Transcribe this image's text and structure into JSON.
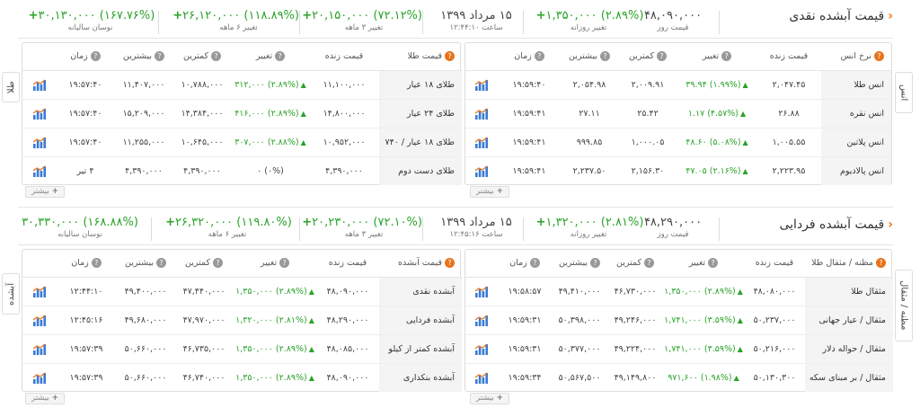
{
  "sections": [
    {
      "title": "قیمت آبشده نقدی",
      "stats": {
        "price": {
          "value": "۴۸,۰۹۰,۰۰۰",
          "label": "قیمت روز"
        },
        "daily": {
          "value": "(۲.۸۹%) ۱,۳۵۰,۰۰۰",
          "label": "تغییر روزانه"
        },
        "date": {
          "value": "۱۵ مرداد ۱۳۹۹",
          "label": "ساعت ۱۲:۴۴:۱۰"
        },
        "m3": {
          "value": "(۷۲.۱۲%) ۲۰,۱۵۰,۰۰۰",
          "label": "تغییر ۳ ماهه"
        },
        "m6": {
          "value": "(۱۱۸.۸۹%) ۲۶,۱۲۰,۰۰۰",
          "label": "تغییر ۶ ماهه"
        },
        "y1": {
          "value": "(۱۶۷.۷۶%) ۳۰,۱۳۰,۰۰۰",
          "label": "نوسان سالیانه"
        }
      },
      "right_panel": {
        "side_tab": "انس",
        "headers": [
          "نرخ انس",
          "قیمت زنده",
          "تغییر",
          "کمترین",
          "بیشترین",
          "زمان"
        ],
        "rows": [
          {
            "name": "انس طلا",
            "price": "۲,۰۴۷.۴۵",
            "change": "(۱.۹۹%) ۳۹.۹۴",
            "low": "۲,۰۰۹.۹۱",
            "high": "۲,۰۵۴.۹۸",
            "time": "۱۹:۵۹:۴۰"
          },
          {
            "name": "انس نقره",
            "price": "۲۶.۸۸",
            "change": "(۴.۵۷%) ۱.۱۷",
            "low": "۲۵.۴۲",
            "high": "۲۷.۱۱",
            "time": "۱۹:۵۹:۴۱"
          },
          {
            "name": "انس پلاتین",
            "price": "۱,۰۰۵.۵۵",
            "change": "(۵.۰۸%) ۴۸.۶۰",
            "low": "۱,۰۰۰.۰۵",
            "high": "۹۹۹.۸۵",
            "time": "۱۹:۵۹:۴۱"
          },
          {
            "name": "انس پالادیوم",
            "price": "۲,۲۲۳.۹۵",
            "change": "(۲.۱۶%) ۴۷.۰۵",
            "low": "۲,۱۵۶.۳۰",
            "high": "۲,۲۳۷.۵۰",
            "time": "۱۹:۵۹:۴۱"
          }
        ]
      },
      "left_panel": {
        "side_tab": "طلا",
        "headers": [
          "قیمت طلا",
          "قیمت زنده",
          "تغییر",
          "کمترین",
          "بیشترین",
          "زمان"
        ],
        "rows": [
          {
            "name": "طلای ۱۸ عیار",
            "price": "۱۱,۱۰۰,۰۰۰",
            "change": "(۲.۸۹%) ۳۱۲,۰۰۰",
            "low": "۱۰,۷۸۸,۰۰۰",
            "high": "۱۱,۴۰۷,۰۰۰",
            "time": "۱۹:۵۷:۴۰",
            "pos": true
          },
          {
            "name": "طلای ۲۴ عیار",
            "price": "۱۴,۸۰۰,۰۰۰",
            "change": "(۲.۸۹%) ۴۱۶,۰۰۰",
            "low": "۱۴,۳۸۴,۰۰۰",
            "high": "۱۵,۲۰۹,۰۰۰",
            "time": "۱۹:۵۷:۴۰",
            "pos": true
          },
          {
            "name": "طلای ۱۸ عیار / ۷۴۰",
            "price": "۱۰,۹۵۲,۰۰۰",
            "change": "(۲.۸۸%) ۳۰۷,۰۰۰",
            "low": "۱۰,۶۴۵,۰۰۰",
            "high": "۱۱,۲۵۵,۰۰۰",
            "time": "۱۹:۵۷:۴۰",
            "pos": true
          },
          {
            "name": "طلای دست دوم",
            "price": "۴,۳۹۰,۰۰۰",
            "change": "(۰%) ۰",
            "low": "۴,۳۹۰,۰۰۰",
            "high": "۴,۳۹۰,۰۰۰",
            "time": "۴ تیر",
            "pos": false
          }
        ]
      }
    },
    {
      "title": "قیمت آبشده فردایی",
      "stats": {
        "price": {
          "value": "۴۸,۲۹۰,۰۰۰",
          "label": "قیمت روز"
        },
        "daily": {
          "value": "(۲.۸۱%) ۱,۳۲۰,۰۰۰",
          "label": "تغییر روزانه"
        },
        "date": {
          "value": "۱۵ مرداد ۱۳۹۹",
          "label": "ساعت ۱۲:۴۵:۱۶"
        },
        "m3": {
          "value": "(۷۲.۱۰%) ۲۰,۲۳۰,۰۰۰",
          "label": "تغییر ۳ ماهه"
        },
        "m6": {
          "value": "(۱۱۹.۸۰%) ۲۶,۳۲۰,۰۰۰",
          "label": "تغییر ۶ ماهه"
        },
        "y1": {
          "value": "(۱۶۸.۸۸%) ۳۰,۳۳۰,۰۰۰",
          "label": "نوسان سالیانه"
        }
      },
      "right_panel": {
        "side_tab": "مظنه / مثقال",
        "headers": [
          "مظنه / مثقال طلا",
          "قیمت زنده",
          "تغییر",
          "کمترین",
          "بیشترین",
          "زمان"
        ],
        "rows": [
          {
            "name": "مثقال طلا",
            "price": "۴۸,۰۸۰,۰۰۰",
            "change": "(۲.۸۹%) ۱,۳۵۰,۰۰۰",
            "low": "۴۶,۷۳۰,۰۰۰",
            "high": "۴۹,۴۱۰,۰۰۰",
            "time": "۱۹:۵۸:۵۷"
          },
          {
            "name": "مثقال / عیار جهانی",
            "price": "۵۰,۲۳۷,۰۰۰",
            "change": "(۳.۵۹%) ۱,۷۴۱,۰۰۰",
            "low": "۴۹,۲۴۶,۰۰۰",
            "high": "۵۰,۳۹۸,۰۰۰",
            "time": "۱۹:۵۹:۳۱"
          },
          {
            "name": "مثقال / حواله دلار",
            "price": "۵۰,۲۱۶,۰۰۰",
            "change": "(۳.۵۹%) ۱,۷۴۱,۰۰۰",
            "low": "۴۹,۲۲۴,۰۰۰",
            "high": "۵۰,۳۷۷,۰۰۰",
            "time": "۱۹:۵۹:۳۱"
          },
          {
            "name": "مثقال / بر مبنای سکه",
            "price": "۵۰,۱۳۰,۳۰۰",
            "change": "(۱.۹۸%) ۹۷۱,۶۰۰",
            "low": "۴۹,۱۴۹,۸۰۰",
            "high": "۵۰,۵۶۷,۵۰۰",
            "time": "۱۹:۵۹:۳۴"
          }
        ]
      },
      "left_panel": {
        "side_tab": "آبشده",
        "headers": [
          "قیمت آبشده",
          "قیمت زنده",
          "تغییر",
          "کمترین",
          "بیشترین",
          "زمان"
        ],
        "rows": [
          {
            "name": "آبشده نقدی",
            "price": "۴۸,۰۹۰,۰۰۰",
            "change": "(۲.۸۹%) ۱,۳۵۰,۰۰۰",
            "low": "۴۷,۴۴۰,۰۰۰",
            "high": "۴۹,۴۰۰,۰۰۰",
            "time": "۱۲:۴۴:۱۰"
          },
          {
            "name": "آبشده فردایی",
            "price": "۴۸,۲۹۰,۰۰۰",
            "change": "(۲.۸۱%) ۱,۳۲۰,۰۰۰",
            "low": "۴۷,۹۷۰,۰۰۰",
            "high": "۴۹,۶۸۰,۰۰۰",
            "time": "۱۲:۴۵:۱۶"
          },
          {
            "name": "آبشده کمتر از کیلو",
            "price": "۴۸,۰۸۵,۰۰۰",
            "change": "(۲.۸۹%) ۱,۳۵۰,۰۰۰",
            "low": "۴۶,۷۳۵,۰۰۰",
            "high": "۵۰,۶۶۰,۰۰۰",
            "time": "۱۹:۵۷:۳۹"
          },
          {
            "name": "آبشده بنکداری",
            "price": "۴۸,۰۹۰,۰۰۰",
            "change": "(۲.۸۹%) ۱,۳۵۰,۰۰۰",
            "low": "۴۶,۷۴۰,۰۰۰",
            "high": "۵۰,۶۶۰,۰۰۰",
            "time": "۱۹:۵۷:۳۹"
          }
        ]
      }
    }
  ],
  "more_label": "بیشتر",
  "colors": {
    "positive": "#29a329",
    "accent": "#e8731a",
    "chart_bars": "#3a7bd5"
  }
}
